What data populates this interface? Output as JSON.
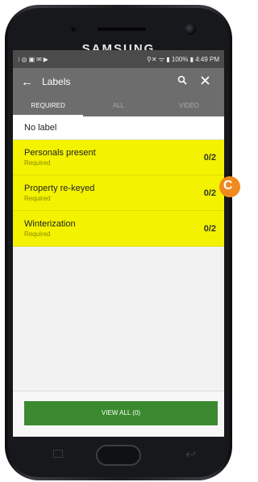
{
  "device": {
    "brand": "SAMSUNG"
  },
  "statusbar": {
    "left_icons": "⁝◎▣✉▶",
    "right_text": "⚲✕ ᯤ ▮ 100% ▮ 4:49 PM"
  },
  "appbar": {
    "title": "Labels"
  },
  "tabs": [
    {
      "label": "REQUIRED"
    },
    {
      "label": "ALL"
    },
    {
      "label": "VIDEO"
    }
  ],
  "no_label": "No label",
  "labels": [
    {
      "name": "Personals present",
      "sub": "Required",
      "count": "0/2"
    },
    {
      "name": "Property re-keyed",
      "sub": "Required",
      "count": "0/2"
    },
    {
      "name": "Winterization",
      "sub": "Required",
      "count": "0/2"
    }
  ],
  "footer": {
    "button": "VIEW ALL (0)"
  },
  "colors": {
    "label_row": "#f3f200",
    "appbar": "#6d6d6d",
    "button": "#3b8a2f"
  }
}
